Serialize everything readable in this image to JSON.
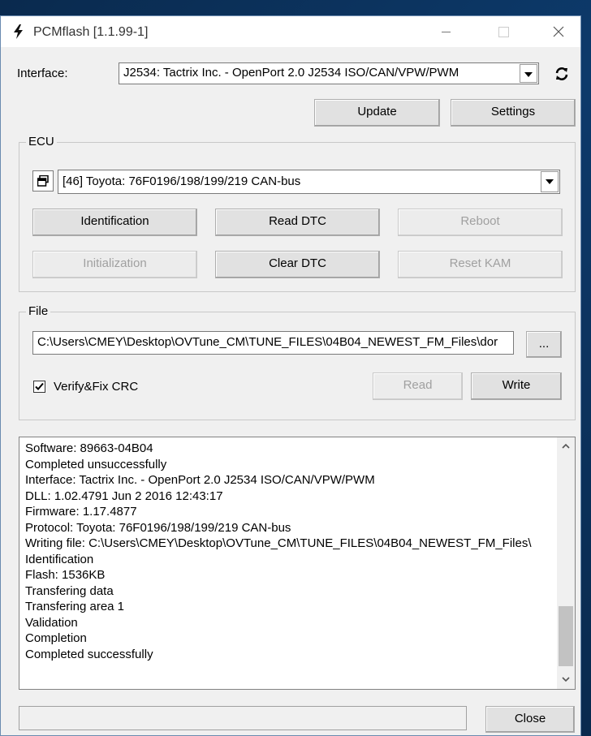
{
  "window": {
    "title": "PCMflash [1.1.99-1]"
  },
  "interface": {
    "label": "Interface:",
    "selected": "J2534: Tactrix Inc. - OpenPort 2.0 J2534 ISO/CAN/VPW/PWM",
    "update_label": "Update",
    "settings_label": "Settings"
  },
  "ecu": {
    "group_label": "ECU",
    "selected": "[46] Toyota: 76F0196/198/199/219 CAN-bus",
    "buttons": {
      "identification": "Identification",
      "read_dtc": "Read DTC",
      "reboot": "Reboot",
      "initialization": "Initialization",
      "clear_dtc": "Clear DTC",
      "reset_kam": "Reset KAM"
    }
  },
  "file": {
    "group_label": "File",
    "path": "C:\\Users\\CMEY\\Desktop\\OVTune_CM\\TUNE_FILES\\04B04_NEWEST_FM_Files\\dor",
    "browse_label": "...",
    "verify_label": "Verify&Fix CRC",
    "verify_checked": true,
    "read_label": "Read",
    "write_label": "Write"
  },
  "log": {
    "lines": [
      "Software: 89663-04B04",
      "Completed unsuccessfully",
      "Interface: Tactrix Inc. - OpenPort 2.0 J2534 ISO/CAN/VPW/PWM",
      "DLL: 1.02.4791 Jun  2 2016 12:43:17",
      "Firmware: 1.17.4877",
      "Protocol: Toyota: 76F0196/198/199/219 CAN-bus",
      "Writing file: C:\\Users\\CMEY\\Desktop\\OVTune_CM\\TUNE_FILES\\04B04_NEWEST_FM_Files\\",
      "Identification",
      "Flash: 1536KB",
      "Transfering data",
      "Transfering area 1",
      "Validation",
      "Completion",
      "Completed successfully"
    ]
  },
  "footer": {
    "close_label": "Close"
  }
}
